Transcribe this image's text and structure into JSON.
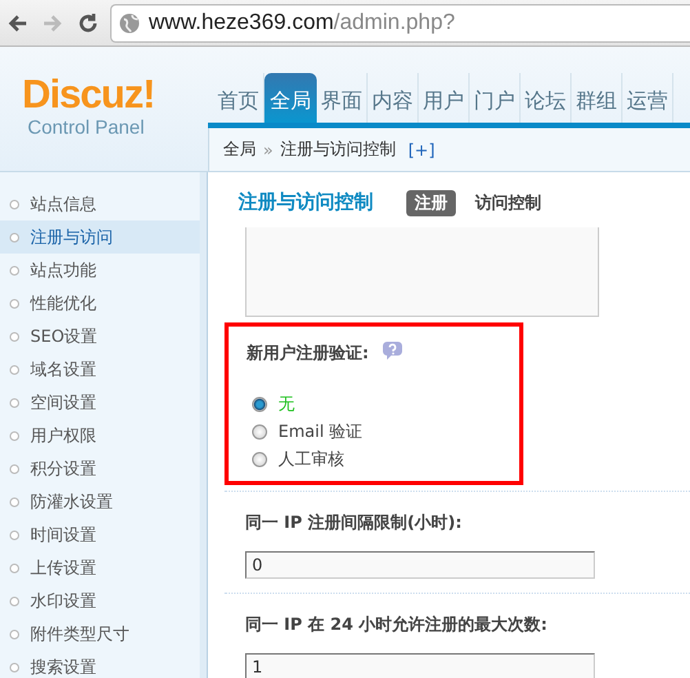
{
  "browser": {
    "url_host": "www.heze369.com",
    "url_path": "/admin.php?"
  },
  "logo": {
    "title": "Discuz!",
    "subtitle": "Control Panel"
  },
  "nav_tabs": [
    {
      "label": "首页",
      "selected": false
    },
    {
      "label": "全局",
      "selected": true
    },
    {
      "label": "界面",
      "selected": false
    },
    {
      "label": "内容",
      "selected": false
    },
    {
      "label": "用户",
      "selected": false
    },
    {
      "label": "门户",
      "selected": false
    },
    {
      "label": "论坛",
      "selected": false
    },
    {
      "label": "群组",
      "selected": false
    },
    {
      "label": "运营",
      "selected": false
    }
  ],
  "breadcrumb": {
    "items": [
      "全局",
      "注册与访问控制"
    ],
    "separator": "»",
    "add": "[+]"
  },
  "sidebar": {
    "items": [
      {
        "label": "站点信息",
        "selected": false
      },
      {
        "label": "注册与访问",
        "selected": true
      },
      {
        "label": "站点功能",
        "selected": false
      },
      {
        "label": "性能优化",
        "selected": false
      },
      {
        "label": "SEO设置",
        "selected": false
      },
      {
        "label": "域名设置",
        "selected": false
      },
      {
        "label": "空间设置",
        "selected": false
      },
      {
        "label": "用户权限",
        "selected": false
      },
      {
        "label": "积分设置",
        "selected": false
      },
      {
        "label": "防灌水设置",
        "selected": false
      },
      {
        "label": "时间设置",
        "selected": false
      },
      {
        "label": "上传设置",
        "selected": false
      },
      {
        "label": "水印设置",
        "selected": false
      },
      {
        "label": "附件类型尺寸",
        "selected": false
      },
      {
        "label": "搜索设置",
        "selected": false
      }
    ]
  },
  "content": {
    "title": "注册与访问控制",
    "tabs": [
      {
        "label": "注册",
        "selected": true
      },
      {
        "label": "访问控制",
        "selected": false
      }
    ],
    "verify": {
      "label": "新用户注册验证:",
      "highlighted": true,
      "options": [
        {
          "label": "无",
          "selected": true
        },
        {
          "label": "Email 验证",
          "selected": false
        },
        {
          "label": "人工审核",
          "selected": false
        }
      ]
    },
    "fields": [
      {
        "label": "同一 IP 注册间隔限制(小时):",
        "value": "0"
      },
      {
        "label": "同一 IP 在 24 小时允许注册的最大次数:",
        "value": "1"
      }
    ]
  }
}
